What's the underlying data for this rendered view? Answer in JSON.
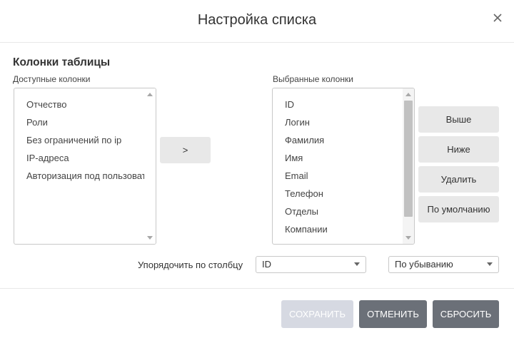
{
  "dialog": {
    "title": "Настройка списка",
    "section_title": "Колонки таблицы"
  },
  "available": {
    "label": "Доступные колонки",
    "items": [
      "Отчество",
      "Роли",
      "Без ограничений по ip",
      "IP-адреса",
      "Авторизация под пользователем"
    ]
  },
  "selected": {
    "label": "Выбранные колонки",
    "items": [
      "ID",
      "Логин",
      "Фамилия",
      "Имя",
      "Email",
      "Телефон",
      "Отделы",
      "Компании"
    ]
  },
  "move_button": ">",
  "side_buttons": {
    "up": "Выше",
    "down": "Ниже",
    "delete": "Удалить",
    "default": "По умолчанию"
  },
  "order": {
    "label": "Упорядочить по столбцу",
    "column_value": "ID",
    "direction_value": "По убыванию"
  },
  "footer": {
    "save": "СОХРАНИТЬ",
    "cancel": "ОТМЕНИТЬ",
    "reset": "СБРОСИТЬ"
  },
  "colors": {
    "primary_disabled": "#d6d9e2",
    "secondary": "#6b7078",
    "neutral_button": "#e8e8e8"
  },
  "icons": {
    "close": "close-icon",
    "scroll_up": "arrow-up-icon",
    "scroll_down": "arrow-down-icon",
    "dropdown": "chevron-down-icon"
  }
}
